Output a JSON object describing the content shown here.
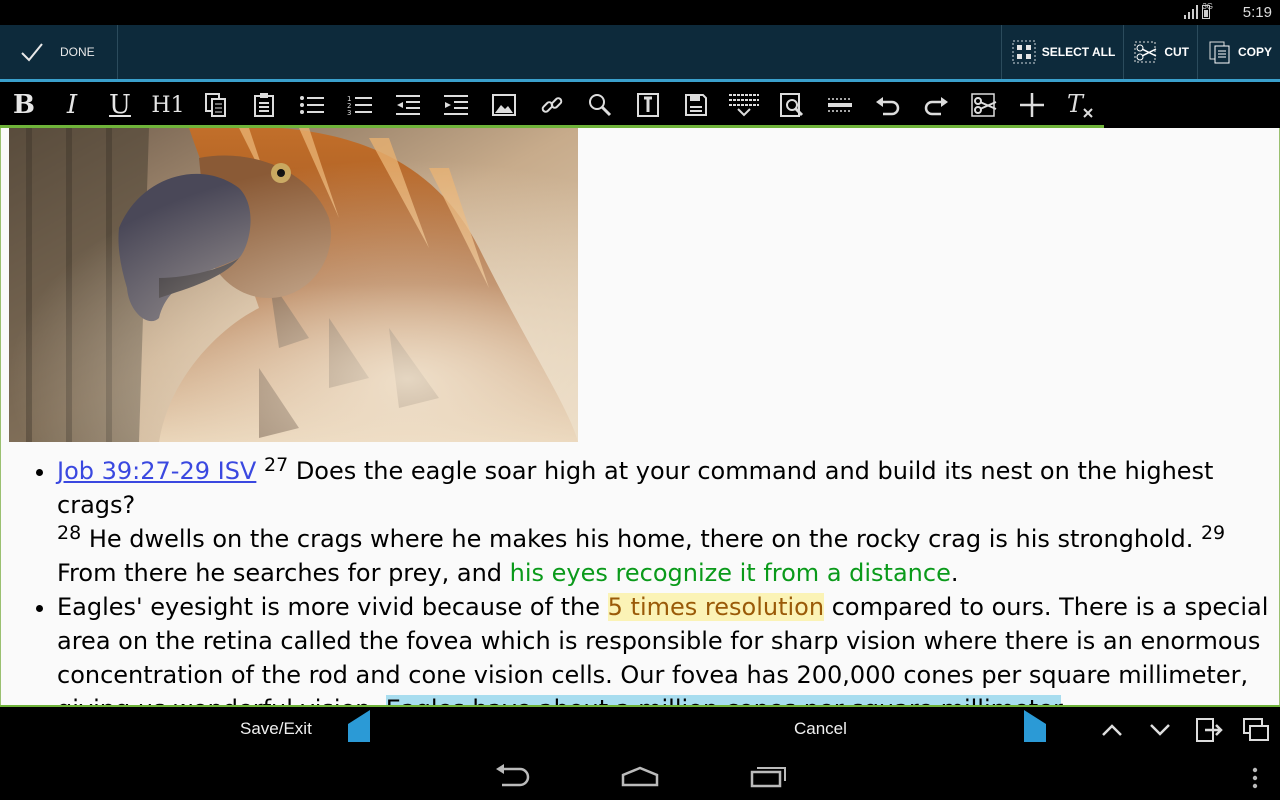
{
  "status_bar": {
    "time": "5:19",
    "network": "3G"
  },
  "action_bar": {
    "done_label": "DONE",
    "select_all_label": "SELECT ALL",
    "cut_label": "CUT",
    "copy_label": "COPY"
  },
  "toolbar": {
    "bold": "B",
    "italic": "I",
    "underline": "U",
    "heading": "H1",
    "icons": [
      "copy-icon",
      "paste-icon",
      "bullet-list-icon",
      "numbered-list-icon",
      "outdent-icon",
      "indent-icon",
      "image-icon",
      "link-icon",
      "search-icon",
      "text-cursor-icon",
      "save-icon",
      "keyboard-icon",
      "find-replace-icon",
      "horizontal-rule-icon",
      "undo-icon",
      "redo-icon",
      "cut-text-icon",
      "add-icon",
      "clear-format-icon"
    ]
  },
  "editor": {
    "image_alt": "eagle photo",
    "bullet1": {
      "ref": "Job 39:27-29 ISV",
      "v27": "27",
      "t27": " Does the eagle soar high at your command and build its nest on the highest crags? ",
      "v28": "28",
      "t28": " He dwells on the crags where he makes his home, there on the rocky crag is his stronghold. ",
      "v29": "29",
      "t29": " From there he searches for prey, and ",
      "green": "his eyes recognize it from a distance",
      "end": "."
    },
    "bullet2": {
      "t1": "Eagles' eyesight is more vivid because of the ",
      "yellow": "5 times resolution",
      "t2": " compared to ours. There is a special area on the retina called the fovea which is responsible for sharp vision where there is an enormous concentration of the rod and cone vision cells. Our fovea has 200,000 cones per square millimeter, giving us wonderful vision. ",
      "blue": "Eagles have about a million cones per square millimeter",
      "end": "."
    }
  },
  "edit_bar": {
    "save_exit": "Save/Exit",
    "cancel": "Cancel"
  },
  "colors": {
    "action_bar": "#0d2a3b",
    "accent_line": "#3aa0cc",
    "green_line": "#6fb33a",
    "link": "#3a48e0",
    "green_text": "#0a9a1a",
    "highlight_yellow": "#fbf3b6",
    "highlight_blue": "#a8ddef"
  }
}
